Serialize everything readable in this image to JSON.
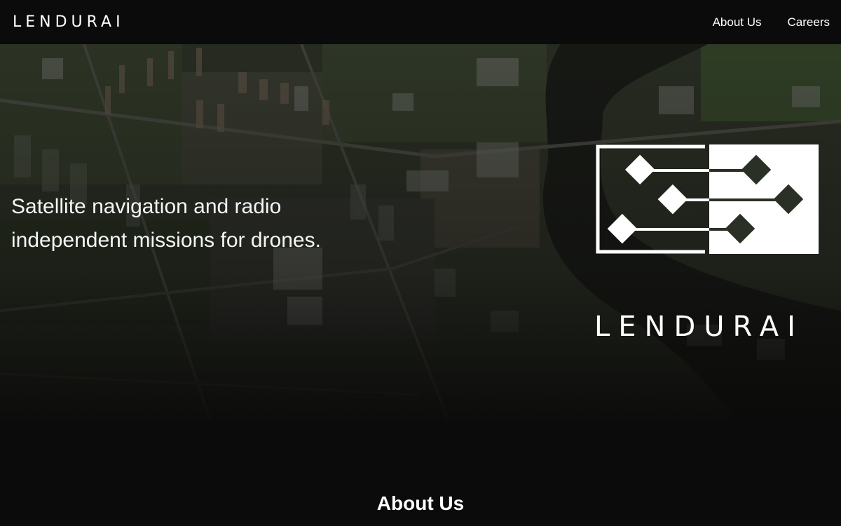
{
  "navbar": {
    "brand": "LENDURAI",
    "links": [
      {
        "label": "About Us"
      },
      {
        "label": "Careers"
      }
    ]
  },
  "hero": {
    "tagline_line1": "Satellite navigation and radio",
    "tagline_line2": "independent missions for drones.",
    "logo_text": "LENDURAI",
    "background": "aerial satellite image of a city with a river"
  },
  "about": {
    "title": "About Us"
  },
  "colors": {
    "page_bg": "#0b0b0b",
    "text": "#ffffff"
  }
}
